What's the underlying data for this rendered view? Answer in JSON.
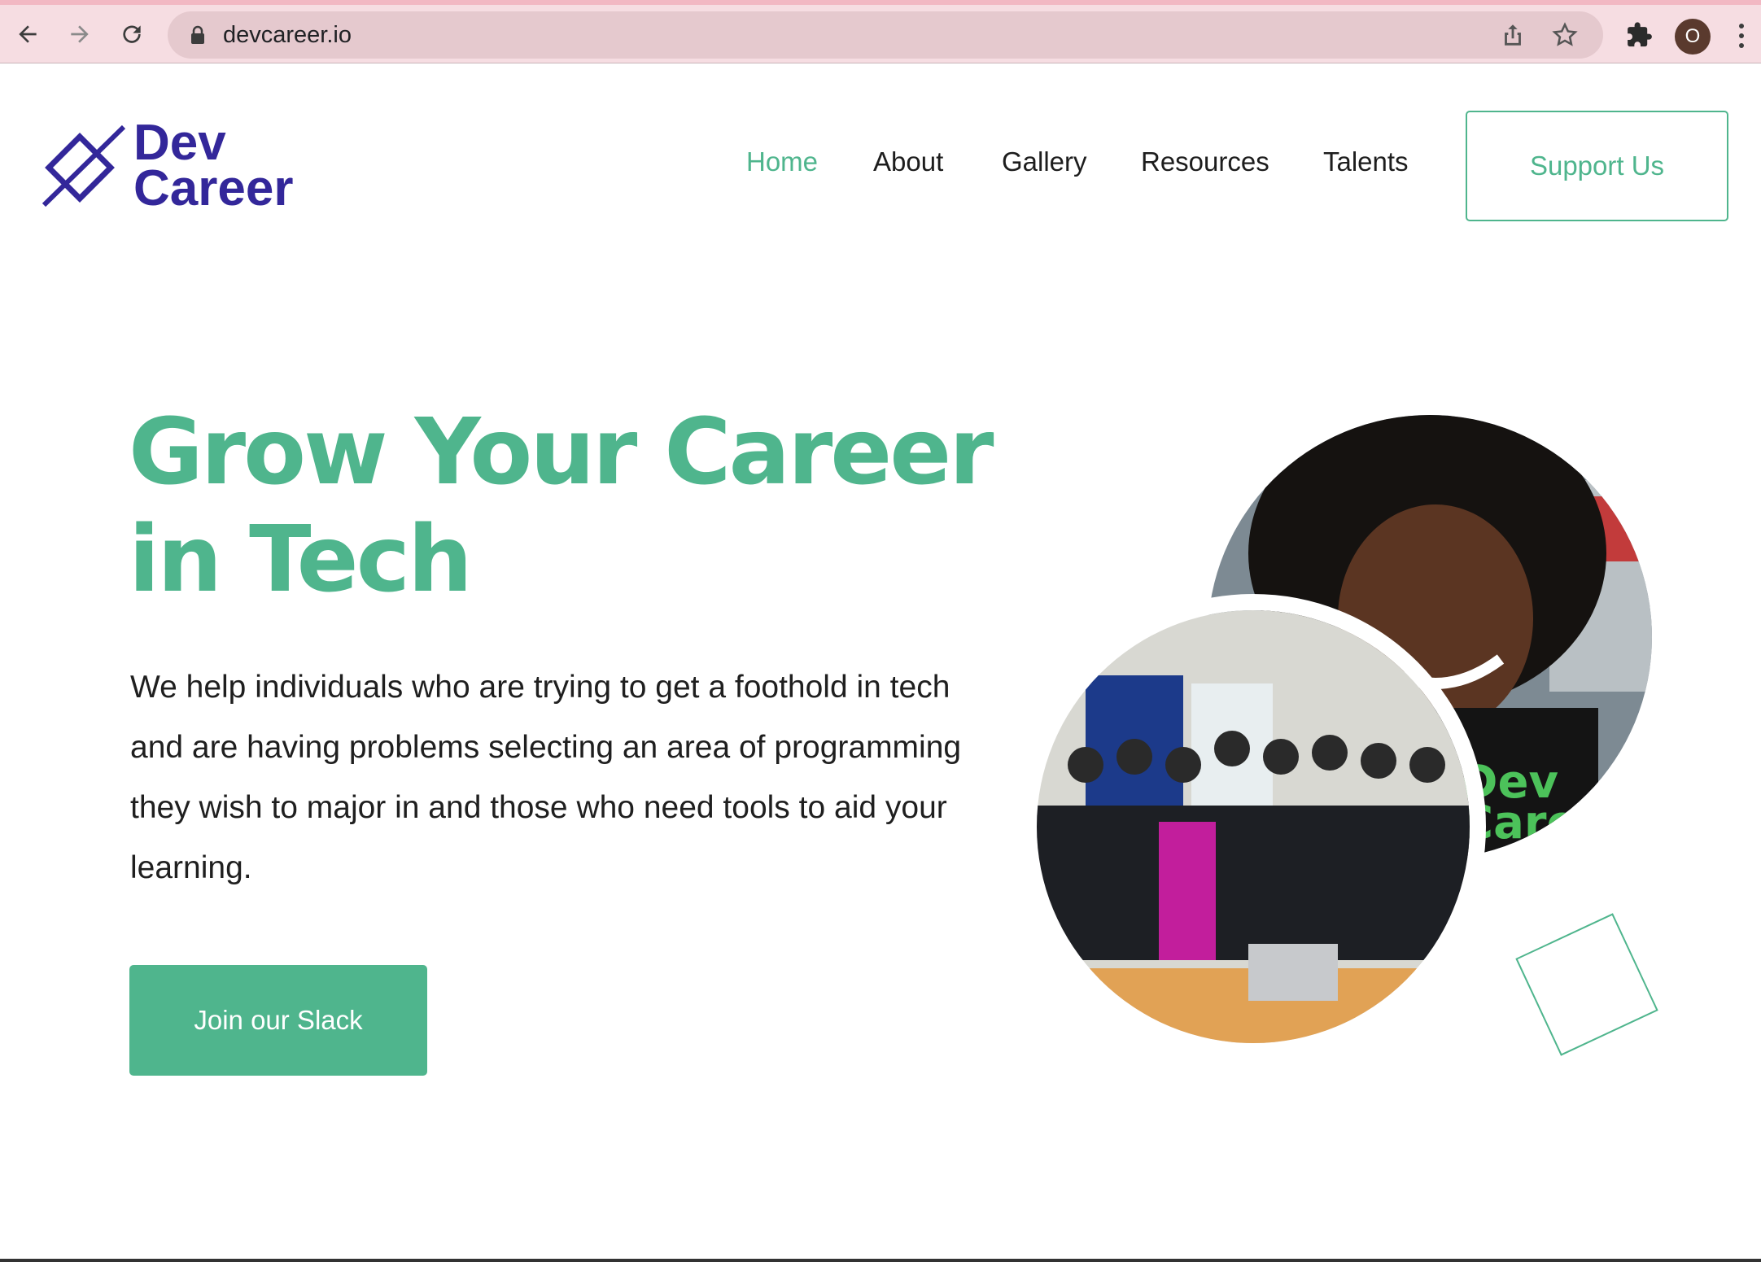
{
  "browser": {
    "url": "devcareer.io",
    "profile_initial": "O",
    "icons": [
      "back-arrow-icon",
      "forward-arrow-icon",
      "reload-icon",
      "lock-icon",
      "share-icon",
      "star-icon",
      "puzzle-icon",
      "kebab-menu-icon"
    ]
  },
  "logo": {
    "line1": "Dev",
    "line2": "Career"
  },
  "nav": {
    "items": [
      {
        "label": "Home",
        "active": true
      },
      {
        "label": "About",
        "active": false
      },
      {
        "label": "Gallery",
        "active": false
      },
      {
        "label": "Resources",
        "active": false
      },
      {
        "label": "Talents",
        "active": false
      }
    ],
    "support_label": "Support Us"
  },
  "hero": {
    "title": "Grow Your Career in Tech",
    "description": "We help individuals who are trying to get a foothold in tech and are having problems selecting an area of programming they wish to major in and those who need tools to aid your learning.",
    "cta_label": "Join our Slack"
  },
  "colors": {
    "accent": "#4fb58d",
    "brand": "#33279a",
    "text": "#1f1f1f"
  }
}
